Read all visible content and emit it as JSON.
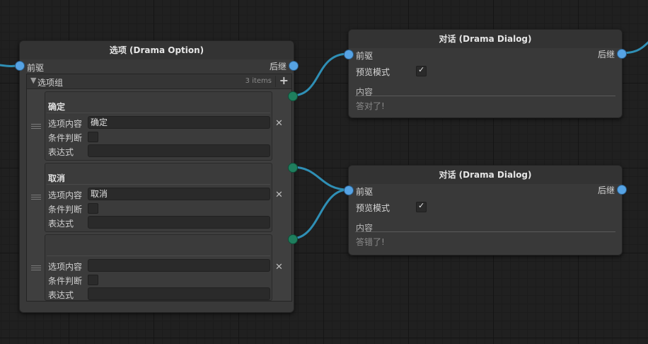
{
  "option_node": {
    "title": "选项 (Drama Option)",
    "input_label": "前驱",
    "output_label": "后继",
    "list": {
      "title": "选项组",
      "count": "3 items",
      "add_label": "+"
    },
    "items": [
      {
        "header": "确定",
        "content_label": "选项内容",
        "content_value": "确定",
        "condition_label": "条件判断",
        "expression_label": "表达式",
        "expression_value": "",
        "remove_label": "✕"
      },
      {
        "header": "取消",
        "content_label": "选项内容",
        "content_value": "取消",
        "condition_label": "条件判断",
        "expression_label": "表达式",
        "expression_value": "",
        "remove_label": "✕"
      },
      {
        "header": "",
        "content_label": "选项内容",
        "content_value": "",
        "condition_label": "条件判断",
        "expression_label": "表达式",
        "expression_value": "",
        "remove_label": "✕"
      }
    ]
  },
  "dialog_nodes": [
    {
      "title": "对话 (Drama Dialog)",
      "input_label": "前驱",
      "output_label": "后继",
      "preview_label": "预览模式",
      "preview_checked": true,
      "content_label": "内容",
      "content_value": "答对了!"
    },
    {
      "title": "对话 (Drama Dialog)",
      "input_label": "前驱",
      "output_label": "后继",
      "preview_label": "预览模式",
      "preview_checked": true,
      "content_label": "内容",
      "content_value": "答错了!"
    }
  ],
  "colors": {
    "edge": "#2f8fb5",
    "input_port": "#56a3e4",
    "item_port": "#1f7f5e"
  }
}
